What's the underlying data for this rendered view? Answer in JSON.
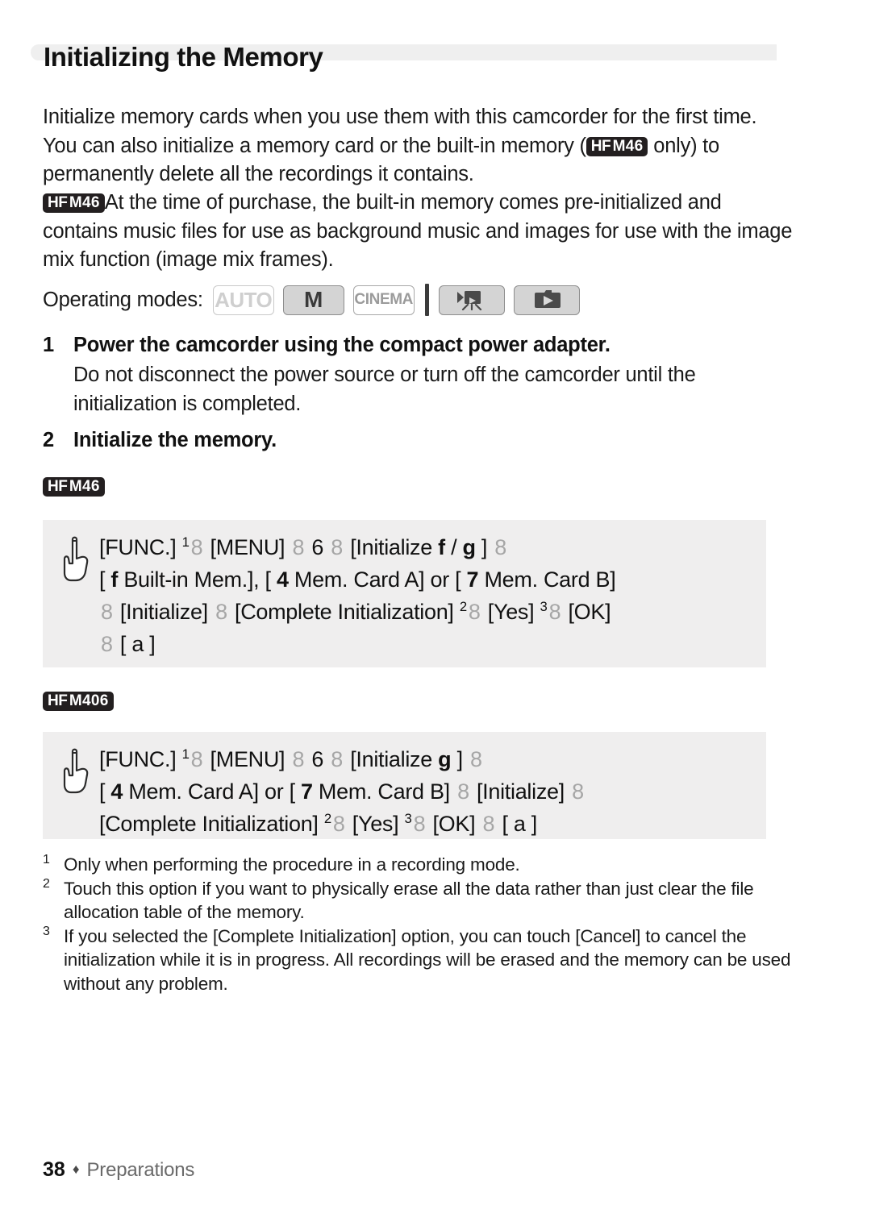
{
  "page": {
    "title": "Initializing the Memory",
    "footer_page_number": "38",
    "footer_diamond": "♦",
    "footer_section": "Preparations"
  },
  "intro": {
    "paragraph1_part1": "Initialize memory cards when you use them with this camcorder for the first time. You can also initialize a memory card or the built-in memory (",
    "paragraph1_badge_hf": "HF",
    "paragraph1_badge_model": "M46",
    "paragraph1_part2": " only) to permanently delete all the recordings it contains.",
    "paragraph2_badge_hf": "HF",
    "paragraph2_badge_model": "M46",
    "paragraph2_text": "At the time of purchase, the built-in memory comes pre-initialized and contains music files for use as background music and images for use with the image mix function (image mix frames)."
  },
  "operating_modes": {
    "label": "Operating modes:",
    "chips": [
      {
        "id": "auto",
        "label": "AUTO",
        "state": "disabled"
      },
      {
        "id": "manual",
        "label": "M",
        "state": "enabled"
      },
      {
        "id": "cinema",
        "label": "CINEMA",
        "state": "disabled"
      },
      {
        "id": "movie-playback",
        "label": "",
        "icon": "movie-playback-icon",
        "state": "enabled"
      },
      {
        "id": "photo-playback",
        "label": "",
        "icon": "photo-playback-icon",
        "state": "enabled"
      }
    ]
  },
  "steps": [
    {
      "number": "1",
      "heading": "Power the camcorder using the compact power adapter.",
      "body": "Do not disconnect the power source or turn off the camcorder until the initialization is completed."
    },
    {
      "number": "2",
      "heading": "Initialize the memory.",
      "body": ""
    }
  ],
  "procedures": [
    {
      "badge_hf": "HF",
      "badge_model": "M46",
      "lines": [
        [
          {
            "t": "text",
            "v": "[FUNC.]"
          },
          {
            "t": "sup",
            "v": "1"
          },
          {
            "t": "arrow",
            "v": "8"
          },
          {
            "t": "text",
            "v": "[MENU]"
          },
          {
            "t": "arrow",
            "v": "8"
          },
          {
            "t": "glyph-plain",
            "v": "6"
          },
          {
            "t": "arrow",
            "v": "8"
          },
          {
            "t": "text",
            "v": "[Initialize"
          },
          {
            "t": "glyph",
            "v": "f"
          },
          {
            "t": "text",
            "v": "/"
          },
          {
            "t": "glyph",
            "v": "g"
          },
          {
            "t": "text",
            "v": "]"
          },
          {
            "t": "arrow",
            "v": "8"
          }
        ],
        [
          {
            "t": "text",
            "v": "["
          },
          {
            "t": "glyph",
            "v": "f"
          },
          {
            "t": "text",
            "v": "Built-in Mem.], ["
          },
          {
            "t": "glyph",
            "v": "4"
          },
          {
            "t": "text",
            "v": "Mem. Card A] or ["
          },
          {
            "t": "glyph",
            "v": "7"
          },
          {
            "t": "text",
            "v": "Mem. Card B]"
          }
        ],
        [
          {
            "t": "arrow",
            "v": "8"
          },
          {
            "t": "text",
            "v": "[Initialize]"
          },
          {
            "t": "arrow",
            "v": "8"
          },
          {
            "t": "text",
            "v": "[Complete Initialization]"
          },
          {
            "t": "sup",
            "v": "2"
          },
          {
            "t": "arrow",
            "v": "8"
          },
          {
            "t": "text",
            "v": "[Yes]"
          },
          {
            "t": "sup",
            "v": "3"
          },
          {
            "t": "arrow",
            "v": "8"
          },
          {
            "t": "text",
            "v": "[OK]"
          }
        ],
        [
          {
            "t": "arrow",
            "v": "8"
          },
          {
            "t": "text",
            "v": "["
          },
          {
            "t": "glyph-plain",
            "v": "a"
          },
          {
            "t": "text",
            "v": "]"
          }
        ]
      ]
    },
    {
      "badge_hf": "HF",
      "badge_model": "M406",
      "lines": [
        [
          {
            "t": "text",
            "v": "[FUNC.]"
          },
          {
            "t": "sup",
            "v": "1"
          },
          {
            "t": "arrow",
            "v": "8"
          },
          {
            "t": "text",
            "v": "[MENU]"
          },
          {
            "t": "arrow",
            "v": "8"
          },
          {
            "t": "glyph-plain",
            "v": "6"
          },
          {
            "t": "arrow",
            "v": "8"
          },
          {
            "t": "text",
            "v": "[Initialize"
          },
          {
            "t": "glyph",
            "v": "g"
          },
          {
            "t": "text",
            "v": "]"
          },
          {
            "t": "arrow",
            "v": "8"
          }
        ],
        [
          {
            "t": "text",
            "v": "["
          },
          {
            "t": "glyph",
            "v": "4"
          },
          {
            "t": "text",
            "v": "Mem. Card A] or ["
          },
          {
            "t": "glyph",
            "v": "7"
          },
          {
            "t": "text",
            "v": "Mem. Card B]"
          },
          {
            "t": "arrow",
            "v": "8"
          },
          {
            "t": "text",
            "v": "[Initialize]"
          },
          {
            "t": "arrow",
            "v": "8"
          }
        ],
        [
          {
            "t": "text",
            "v": "[Complete Initialization]"
          },
          {
            "t": "sup",
            "v": "2"
          },
          {
            "t": "arrow",
            "v": "8"
          },
          {
            "t": "text",
            "v": "[Yes]"
          },
          {
            "t": "sup",
            "v": "3"
          },
          {
            "t": "arrow",
            "v": "8"
          },
          {
            "t": "text",
            "v": "[OK]"
          },
          {
            "t": "arrow",
            "v": "8"
          },
          {
            "t": "text",
            "v": "["
          },
          {
            "t": "glyph-plain",
            "v": "a"
          },
          {
            "t": "text",
            "v": "]"
          }
        ]
      ]
    }
  ],
  "footnotes": [
    {
      "mark": "1",
      "text": "Only when performing the procedure in a recording mode."
    },
    {
      "mark": "2",
      "text": "Touch this option if you want to physically erase all the data rather than just clear the file allocation table of the memory."
    },
    {
      "mark": "3",
      "text": "If you selected the [Complete Initialization] option, you can touch [Cancel] to cancel the initialization while it is in progress. All recordings will be erased and the memory can be used without any problem."
    }
  ],
  "colors": {
    "badge_bg": "#231f20",
    "box_bg": "#efeeee",
    "title_bar_bg": "#efefef",
    "arrow_grey": "#a6a6a6",
    "chip_on_bg": "#d4d4d4",
    "chip_border": "#8d8d8d"
  }
}
